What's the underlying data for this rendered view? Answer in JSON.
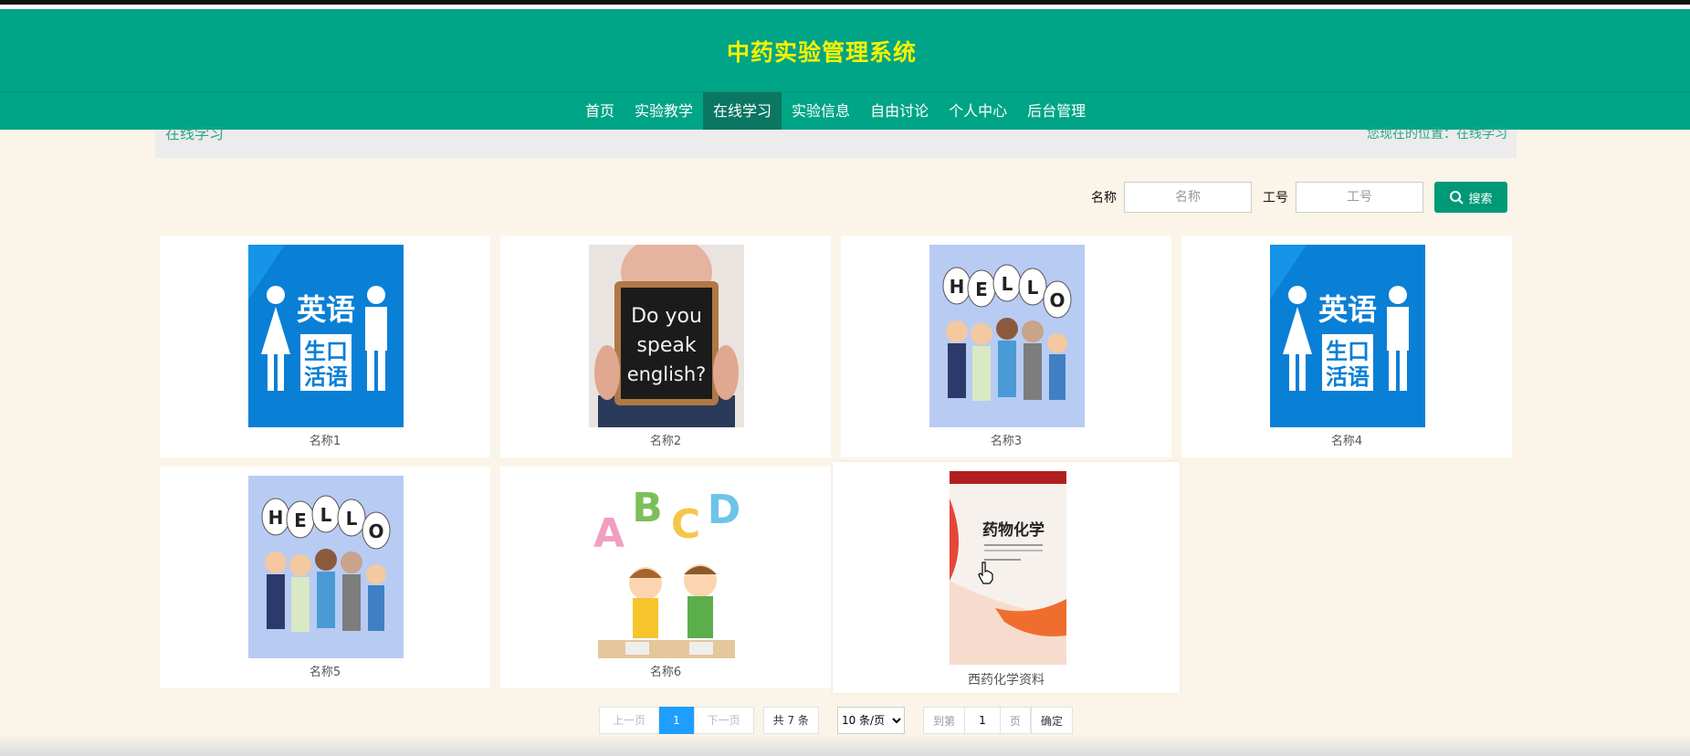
{
  "header": {
    "title": "中药实验管理系统"
  },
  "nav": {
    "items": [
      {
        "label": "首页"
      },
      {
        "label": "实验教学"
      },
      {
        "label": "在线学习"
      },
      {
        "label": "实验信息"
      },
      {
        "label": "自由讨论"
      },
      {
        "label": "个人中心"
      },
      {
        "label": "后台管理"
      }
    ],
    "active": "在线学习"
  },
  "breadcrumb": {
    "title": "在线学习",
    "path": "您现在的位置：在线学习"
  },
  "search": {
    "name_label": "名称",
    "name_placeholder": "名称",
    "id_label": "工号",
    "id_placeholder": "工号",
    "button_label": "搜索"
  },
  "cards": [
    {
      "name": "名称1",
      "image": "english-oral-image"
    },
    {
      "name": "名称2",
      "image": "do-you-speak-english-image"
    },
    {
      "name": "名称3",
      "image": "hello-kids-image"
    },
    {
      "name": "名称4",
      "image": "english-oral-image"
    },
    {
      "name": "名称5",
      "image": "hello-kids-image"
    },
    {
      "name": "名称6",
      "image": "abcd-kids-image"
    },
    {
      "name": "西药化学资料",
      "image": "medicinal-chemistry-book-image"
    }
  ],
  "images": {
    "english_oral": {
      "line1": "英语",
      "line2a": "生口",
      "line2b": "活语"
    },
    "speak": {
      "line1": "Do you",
      "line2": "speak",
      "line3": "english?"
    },
    "hello": [
      "H",
      "E",
      "L",
      "L",
      "O"
    ],
    "abcd": [
      "A",
      "B",
      "C",
      "D"
    ],
    "book": {
      "title": "药物化学"
    }
  },
  "pagination": {
    "prev": "上一页",
    "current": "1",
    "next": "下一页",
    "total": "共 7 条",
    "per_page": "10 条/页",
    "goto_label": "到第",
    "goto_value": "1",
    "page_suffix": "页",
    "confirm": "确定"
  },
  "colors": {
    "primary": "#00a486",
    "title": "#f5f200",
    "active_nav": "#0b7661",
    "page_bg": "#fbf4e8",
    "pager_active": "#1e9fff"
  }
}
